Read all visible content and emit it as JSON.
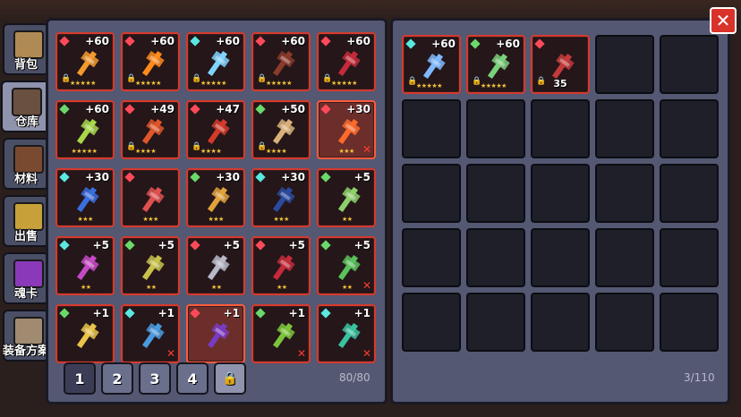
{
  "side_tabs": [
    {
      "label": "背包",
      "icon": "backpack-icon",
      "active": false
    },
    {
      "label": "仓库",
      "icon": "warehouse-chest-icon",
      "active": true
    },
    {
      "label": "材料",
      "icon": "materials-crate-icon",
      "active": false
    },
    {
      "label": "出售",
      "icon": "sell-gold-icon",
      "active": false
    },
    {
      "label": "魂卡",
      "icon": "soul-card-icon",
      "active": false
    },
    {
      "label": "装备方案",
      "icon": "equipment-plan-icon",
      "active": false
    }
  ],
  "warehouse": {
    "items": [
      {
        "plus": "+60",
        "gem": "red",
        "lock": true,
        "stars": 5,
        "equipped": false,
        "discard": false,
        "icon": "fire-staff-icon",
        "color": "#f29a2e"
      },
      {
        "plus": "+60",
        "gem": "red",
        "lock": true,
        "stars": 5,
        "equipped": false,
        "discard": false,
        "icon": "pumpkin-icon",
        "color": "#ff8a1c"
      },
      {
        "plus": "+60",
        "gem": "cyan",
        "lock": true,
        "stars": 5,
        "equipped": false,
        "discard": false,
        "icon": "ice-bow-icon",
        "color": "#7fd3ff"
      },
      {
        "plus": "+60",
        "gem": "red",
        "lock": true,
        "stars": 5,
        "equipped": false,
        "discard": false,
        "icon": "dark-gauntlet-icon",
        "color": "#8b3a2a"
      },
      {
        "plus": "+60",
        "gem": "red",
        "lock": true,
        "stars": 5,
        "equipped": false,
        "discard": false,
        "icon": "crimson-scythe-icon",
        "color": "#c42a3a"
      },
      {
        "plus": "+60",
        "gem": "green",
        "lock": false,
        "stars": 5,
        "equipped": false,
        "discard": false,
        "icon": "nature-cross-icon",
        "color": "#a6d84a"
      },
      {
        "plus": "+49",
        "gem": "red",
        "lock": true,
        "stars": 4,
        "equipped": false,
        "discard": false,
        "icon": "flame-blaster-icon",
        "color": "#e0552a"
      },
      {
        "plus": "+47",
        "gem": "red",
        "lock": true,
        "stars": 4,
        "equipped": false,
        "discard": false,
        "icon": "red-sword-icon",
        "color": "#d33a2a"
      },
      {
        "plus": "+50",
        "gem": "green",
        "lock": true,
        "stars": 4,
        "equipped": false,
        "discard": false,
        "icon": "stone-golem-icon",
        "color": "#d9b07a"
      },
      {
        "plus": "+30",
        "gem": "red",
        "lock": false,
        "stars": 3,
        "equipped": true,
        "discard": true,
        "icon": "magma-staff-icon",
        "color": "#ff6a2a"
      },
      {
        "plus": "+30",
        "gem": "cyan",
        "lock": false,
        "stars": 3,
        "equipped": false,
        "discard": false,
        "icon": "blue-creature-icon",
        "color": "#3a6fe0"
      },
      {
        "plus": "",
        "gem": "red",
        "lock": false,
        "stars": 3,
        "equipped": false,
        "discard": false,
        "icon": "octopus-icon",
        "color": "#e05050"
      },
      {
        "plus": "+30",
        "gem": "green",
        "lock": false,
        "stars": 3,
        "equipped": false,
        "discard": false,
        "icon": "golden-horn-icon",
        "color": "#e0a23a"
      },
      {
        "plus": "+30",
        "gem": "cyan",
        "lock": false,
        "stars": 3,
        "equipped": false,
        "discard": false,
        "icon": "shadow-claw-icon",
        "color": "#2a4aa0"
      },
      {
        "plus": "+5",
        "gem": "green",
        "lock": false,
        "stars": 2,
        "equipped": false,
        "discard": false,
        "icon": "green-blob-icon",
        "color": "#8ed06a"
      },
      {
        "plus": "+5",
        "gem": "cyan",
        "lock": false,
        "stars": 2,
        "equipped": false,
        "discard": false,
        "icon": "purple-wand-icon",
        "color": "#c44ac4"
      },
      {
        "plus": "+5",
        "gem": "green",
        "lock": false,
        "stars": 2,
        "equipped": false,
        "discard": false,
        "icon": "gold-ring-icon",
        "color": "#c9c24a"
      },
      {
        "plus": "+5",
        "gem": "red",
        "lock": false,
        "stars": 2,
        "equipped": false,
        "discard": false,
        "icon": "battle-axe-icon",
        "color": "#b8b8c8"
      },
      {
        "plus": "+5",
        "gem": "red",
        "lock": false,
        "stars": 2,
        "equipped": false,
        "discard": false,
        "icon": "red-fang-icon",
        "color": "#c42a3a"
      },
      {
        "plus": "+5",
        "gem": "green",
        "lock": false,
        "stars": 2,
        "equipped": false,
        "discard": true,
        "icon": "green-hook-icon",
        "color": "#5ac25a"
      },
      {
        "plus": "+1",
        "gem": "green",
        "lock": false,
        "stars": 0,
        "equipped": false,
        "discard": false,
        "icon": "golden-sword-icon",
        "color": "#e8c44a"
      },
      {
        "plus": "+1",
        "gem": "cyan",
        "lock": false,
        "stars": 0,
        "equipped": false,
        "discard": true,
        "icon": "blue-spear-icon",
        "color": "#4a9ae0"
      },
      {
        "plus": "+1",
        "gem": "red",
        "lock": false,
        "stars": 0,
        "equipped": true,
        "discard": false,
        "icon": "purple-helm-icon",
        "color": "#7a3ac4"
      },
      {
        "plus": "+1",
        "gem": "green",
        "lock": false,
        "stars": 0,
        "equipped": false,
        "discard": true,
        "icon": "green-bow-icon",
        "color": "#7ac43a"
      },
      {
        "plus": "+1",
        "gem": "cyan",
        "lock": false,
        "stars": 0,
        "equipped": false,
        "discard": true,
        "icon": "emerald-sword-icon",
        "color": "#3ac2a0"
      }
    ],
    "pages": [
      "1",
      "2",
      "3",
      "4"
    ],
    "active_page": "1",
    "lock_icon": "lock-icon",
    "capacity": "80/80"
  },
  "backpack": {
    "items": [
      {
        "plus": "+60",
        "gem": "cyan",
        "lock": true,
        "stars": 5,
        "icon": "ice-spear-icon",
        "color": "#7fb8ff"
      },
      {
        "plus": "+60",
        "gem": "green",
        "lock": true,
        "stars": 5,
        "icon": "jade-sword-icon",
        "color": "#7ad07a"
      },
      {
        "plus": "",
        "gem": "red",
        "lock": true,
        "stars": 0,
        "icon": "red-beast-icon",
        "color": "#c43a3a",
        "count": "35"
      }
    ],
    "capacity": "3/110"
  },
  "close_icon": "close-icon",
  "gem_colors": {
    "red": "#ff4a5a",
    "cyan": "#5ae8e0",
    "green": "#6ad86a"
  }
}
